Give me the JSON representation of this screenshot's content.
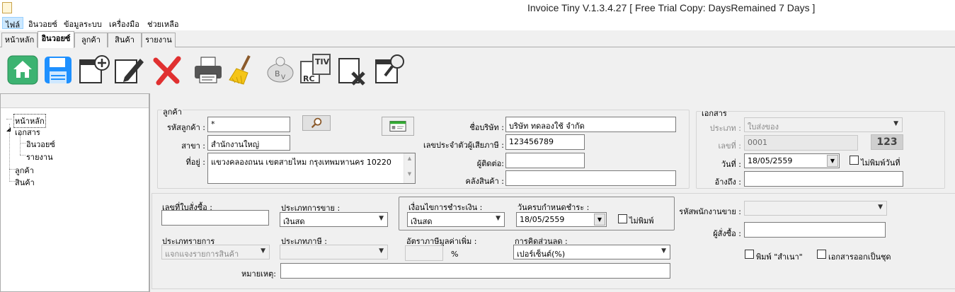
{
  "window": {
    "title": "Invoice Tiny  V.1.3.4.27 [ Free Trial Copy: DaysRemained 7 Days ]"
  },
  "menu": {
    "items": [
      "ไฟล์",
      "อินวอยซ์",
      "ข้อมูลระบบ",
      "เครื่องมือ",
      "ช่วยเหลือ"
    ]
  },
  "tabs": [
    "หน้าหลัก",
    "อินวอยซ์",
    "ลูกค้า",
    "สินค้า",
    "รายงาน"
  ],
  "toolbar": {
    "icons": [
      "home-icon",
      "save-icon",
      "new-document-icon",
      "edit-icon",
      "delete-icon",
      "print-icon",
      "clear-broom-icon",
      "piggy-bank-icon",
      "convert-document-icon",
      "cancel-document-icon",
      "search-document-icon"
    ]
  },
  "tree": {
    "nodes": [
      "หน้าหลัก",
      "เอกสาร",
      "อินวอยซ์",
      "รายงาน",
      "ลูกค้า",
      "สินค้า"
    ]
  },
  "customer": {
    "group_title": "ลูกค้า",
    "code_label": "รหัสลูกค้า :",
    "code_value": "*",
    "branch_label": "สาขา :",
    "branch_value": "สำนักงานใหญ่",
    "address_label": "ที่อยู่ :",
    "address_value": "แขวงคลองถนน เขตสายไหม กรุงเทพมหานคร 10220",
    "company_label": "ชื่อบริษัท :",
    "company_value": "บริษัท ทดลองใช้ จำกัด",
    "taxid_label": "เลขประจำตัวผู้เสียภาษี :",
    "taxid_value": "123456789",
    "contact_label": "ผู้ติดต่อ:",
    "contact_value": "",
    "warehouse_label": "คลังสินค้า :",
    "warehouse_value": ""
  },
  "document": {
    "group_title": "เอกสาร",
    "type_label": "ประเภท :",
    "type_value": "ใบส่งของ",
    "number_label": "เลขที่ :",
    "number_value": "0001",
    "number_button": "123",
    "date_label": "วันที่ :",
    "date_value": "18/05/2559",
    "no_print_date_label": "ไม่พิมพ์วันที่",
    "reference_label": "อ้างถึง :",
    "reference_value": ""
  },
  "order": {
    "po_label": "เลขที่ใบสั่งซื้อ :",
    "po_value": "",
    "sale_type_label": "ประเภทการขาย :",
    "sale_type_value": "เงินสด",
    "payment_group_title": "เงื่อนไขการชำระเงิน :",
    "payment_value": "เงินสด",
    "due_date_label": "วันครบกำหนดชำระ :",
    "due_date_value": "18/05/2559",
    "no_print_label": "ไม่พิมพ์",
    "item_type_label": "ประเภทรายการ",
    "item_type_value": "แจกแจงรายการสินค้า",
    "tax_type_label": "ประเภทภาษี :",
    "tax_type_value": "",
    "vat_label": "อัตราภาษีมูลค่าเพิ่ม :",
    "vat_value": "",
    "vat_unit": "%",
    "discount_label": "การคิดส่วนลด :",
    "discount_value": "เปอร์เซ็นต์(%)",
    "remark_label": "หมายเหตุ:",
    "remark_value": "",
    "salesperson_label": "รหัสพนักงานขาย :",
    "salesperson_value": "",
    "buyer_label": "ผู้สั่งซื้อ :",
    "buyer_value": "",
    "print_copy_label": "พิมพ์ \"สำเนา\"",
    "doc_set_label": "เอกสารออกเป็นชุด"
  }
}
